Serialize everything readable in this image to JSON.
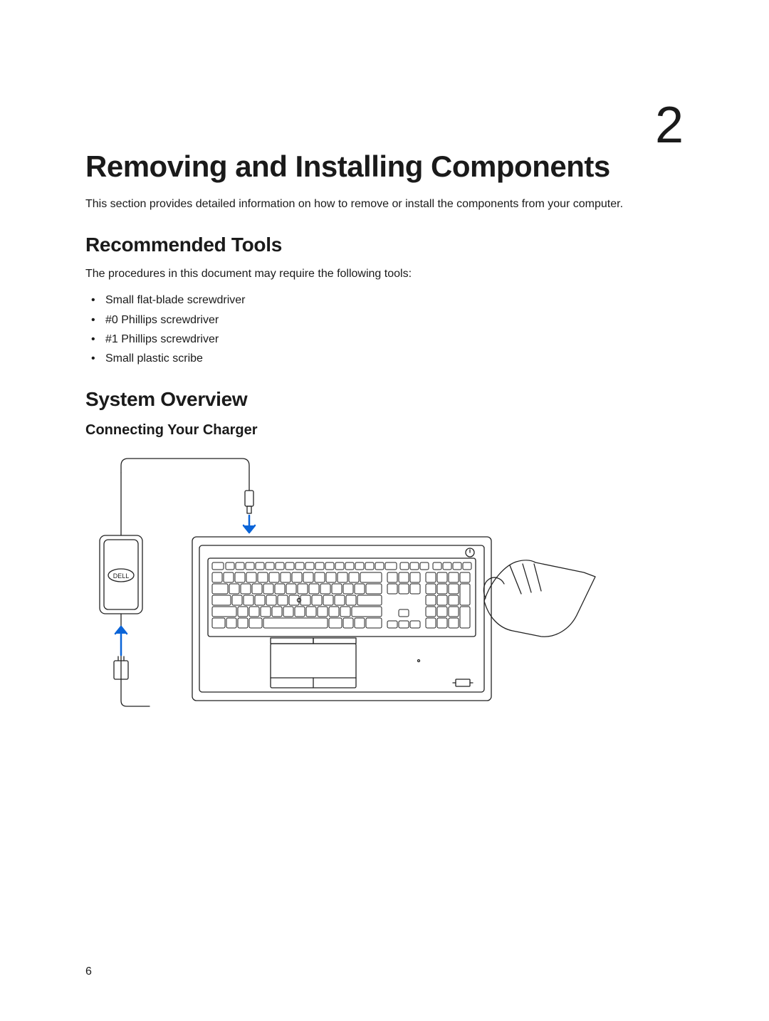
{
  "chapter_number": "2",
  "heading": "Removing and Installing Components",
  "intro": "This section provides detailed information on how to remove or install the components from your computer.",
  "section_tools": {
    "title": "Recommended Tools",
    "lead": "The procedures in this document may require the following tools:",
    "items": [
      "Small flat-blade screwdriver",
      "#0 Phillips screwdriver",
      "#1 Phillips screwdriver",
      "Small plastic scribe"
    ]
  },
  "section_overview": {
    "title": "System Overview",
    "subsection_title": "Connecting Your Charger",
    "figure_alt": "Line drawing of a Dell laptop top view with keyboard and trackpad. A power adapter labeled DELL is shown to the left with a cable; a blue arrow points up from the wall plug into the adapter, and a second blue arrow points down from the barrel connector into the charging port on the laptop's rear edge. A hand on the right reaches toward the power button at the upper-right of the keyboard deck.",
    "adapter_label": "DELL"
  },
  "page_number": "6"
}
